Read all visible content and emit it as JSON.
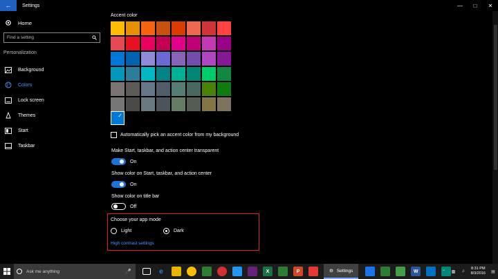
{
  "window": {
    "title": "Settings"
  },
  "sidebar": {
    "home": "Home",
    "search_placeholder": "Find a setting",
    "section": "Personalization",
    "items": [
      {
        "label": "Background",
        "icon": "image-icon"
      },
      {
        "label": "Colors",
        "icon": "palette-icon",
        "active": true
      },
      {
        "label": "Lock screen",
        "icon": "lock-screen-icon"
      },
      {
        "label": "Themes",
        "icon": "themes-icon"
      },
      {
        "label": "Start",
        "icon": "start-icon"
      },
      {
        "label": "Taskbar",
        "icon": "taskbar-icon"
      }
    ]
  },
  "main": {
    "accent_title": "Accent color",
    "swatches": [
      "#FFB900",
      "#E79000",
      "#F7630C",
      "#CA5010",
      "#DA3B01",
      "#EF6950",
      "#D13438",
      "#FF4343",
      "#E74856",
      "#E81123",
      "#EA005E",
      "#C30052",
      "#E3008C",
      "#BF0077",
      "#C239B3",
      "#9A0089",
      "#0078D7",
      "#0063B1",
      "#8E8CD8",
      "#6B69D6",
      "#8764B8",
      "#744DA9",
      "#B146C2",
      "#881798",
      "#0099BC",
      "#2D7D9A",
      "#00B7C3",
      "#038387",
      "#00B294",
      "#018574",
      "#00CC6A",
      "#10893E",
      "#7A7574",
      "#5D5A58",
      "#68768A",
      "#515C6B",
      "#567C73",
      "#486860",
      "#498205",
      "#107C10",
      "#767676",
      "#4C4A48",
      "#69797E",
      "#4A5459",
      "#647C64",
      "#525E54",
      "#847545",
      "#7E735F"
    ],
    "current_accent": "#0078D7",
    "auto_pick_label": "Automatically pick an accent color from my background",
    "transparent_label": "Make Start, taskbar, and action center transparent",
    "transparent_state": "On",
    "show_color_start_label": "Show color on Start, taskbar, and action center",
    "show_color_start_state": "On",
    "show_color_title_label": "Show color on title bar",
    "show_color_title_state": "Off",
    "app_mode_title": "Choose your app mode",
    "app_mode_light": "Light",
    "app_mode_dark": "Dark",
    "high_contrast_link": "High contrast settings"
  },
  "taskbar": {
    "search_placeholder": "Ask me anything",
    "settings_label": "Settings",
    "time": "8:31 PM",
    "date": "8/3/2016"
  }
}
